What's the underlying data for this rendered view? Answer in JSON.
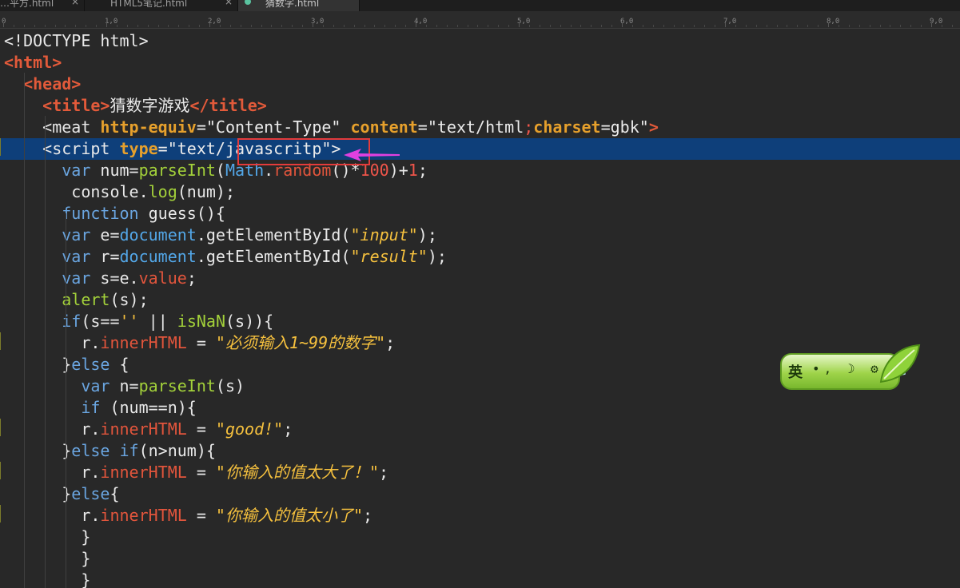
{
  "tabs": [
    {
      "label": "…平方.html",
      "close": "×",
      "active": false
    },
    {
      "label": "HTML5笔记.html",
      "close": "×",
      "active": false
    },
    {
      "label": "猜数字.html",
      "close": "",
      "active": true
    }
  ],
  "ruler": {
    "marks": [
      "0",
      "1,0",
      "2,0",
      "3,0",
      "4,0",
      "5,0",
      "6,0",
      "7,0",
      "8,0",
      "9,0"
    ]
  },
  "code_lines": [
    [
      {
        "t": "<!DOCTYPE html>",
        "c": "plain"
      }
    ],
    [
      {
        "t": "<html>",
        "c": "tag"
      }
    ],
    [
      {
        "t": "  ",
        "c": "plain"
      },
      {
        "t": "<head>",
        "c": "tag"
      }
    ],
    [
      {
        "t": "    ",
        "c": "plain"
      },
      {
        "t": "<title>",
        "c": "tag"
      },
      {
        "t": "猜数字游戏",
        "c": "plain"
      },
      {
        "t": "</title>",
        "c": "tag"
      }
    ],
    [
      {
        "t": "    <meat ",
        "c": "plain"
      },
      {
        "t": "http-equiv",
        "c": "attr"
      },
      {
        "t": "=\"Content-Type\" ",
        "c": "str"
      },
      {
        "t": "content",
        "c": "attr"
      },
      {
        "t": "=\"text/html",
        "c": "str"
      },
      {
        "t": ";",
        "c": "num"
      },
      {
        "t": "charset",
        "c": "attr"
      },
      {
        "t": "=gbk\"",
        "c": "str"
      },
      {
        "t": ">",
        "c": "tag"
      }
    ],
    [
      {
        "t": "    <script ",
        "c": "plain"
      },
      {
        "t": "type",
        "c": "attr"
      },
      {
        "t": "=\"text/javascritp\">",
        "c": "str"
      }
    ],
    [
      {
        "t": "      ",
        "c": "plain"
      },
      {
        "t": "var",
        "c": "kw"
      },
      {
        "t": " num=",
        "c": "plain"
      },
      {
        "t": "parseInt",
        "c": "fn"
      },
      {
        "t": "(",
        "c": "plain"
      },
      {
        "t": "Math",
        "c": "obj"
      },
      {
        "t": ".",
        "c": "plain"
      },
      {
        "t": "random",
        "c": "prop"
      },
      {
        "t": "()*",
        "c": "plain"
      },
      {
        "t": "100",
        "c": "num"
      },
      {
        "t": ")+",
        "c": "plain"
      },
      {
        "t": "1",
        "c": "num"
      },
      {
        "t": ";",
        "c": "plain"
      }
    ],
    [
      {
        "t": "       console.",
        "c": "plain"
      },
      {
        "t": "log",
        "c": "fn"
      },
      {
        "t": "(num);",
        "c": "plain"
      }
    ],
    [
      {
        "t": "      ",
        "c": "plain"
      },
      {
        "t": "function",
        "c": "kw"
      },
      {
        "t": " guess(){",
        "c": "plain"
      }
    ],
    [
      {
        "t": "      ",
        "c": "plain"
      },
      {
        "t": "var",
        "c": "kw"
      },
      {
        "t": " e=",
        "c": "plain"
      },
      {
        "t": "document",
        "c": "obj"
      },
      {
        "t": ".getElementById(",
        "c": "plain"
      },
      {
        "t": "\"input\"",
        "c": "ital"
      },
      {
        "t": ");",
        "c": "plain"
      }
    ],
    [
      {
        "t": "      ",
        "c": "plain"
      },
      {
        "t": "var",
        "c": "kw"
      },
      {
        "t": " r=",
        "c": "plain"
      },
      {
        "t": "document",
        "c": "obj"
      },
      {
        "t": ".getElementById(",
        "c": "plain"
      },
      {
        "t": "\"result\"",
        "c": "ital"
      },
      {
        "t": ");",
        "c": "plain"
      }
    ],
    [
      {
        "t": "      ",
        "c": "plain"
      },
      {
        "t": "var",
        "c": "kw"
      },
      {
        "t": " s=e.",
        "c": "plain"
      },
      {
        "t": "value",
        "c": "prop"
      },
      {
        "t": ";",
        "c": "plain"
      }
    ],
    [
      {
        "t": "      ",
        "c": "plain"
      },
      {
        "t": "alert",
        "c": "fn"
      },
      {
        "t": "(s);",
        "c": "plain"
      }
    ],
    [
      {
        "t": "      ",
        "c": "plain"
      },
      {
        "t": "if",
        "c": "kw"
      },
      {
        "t": "(s==",
        "c": "plain"
      },
      {
        "t": "''",
        "c": "ital"
      },
      {
        "t": " || ",
        "c": "plain"
      },
      {
        "t": "isNaN",
        "c": "fn"
      },
      {
        "t": "(s)){",
        "c": "plain"
      }
    ],
    [
      {
        "t": "        r.",
        "c": "plain"
      },
      {
        "t": "innerHTML",
        "c": "prop"
      },
      {
        "t": " = ",
        "c": "plain"
      },
      {
        "t": "\"必须输入1~99的数字\"",
        "c": "ital"
      },
      {
        "t": ";",
        "c": "plain"
      }
    ],
    [
      {
        "t": "      }",
        "c": "plain"
      },
      {
        "t": "else",
        "c": "kw"
      },
      {
        "t": " {",
        "c": "plain"
      }
    ],
    [
      {
        "t": "        ",
        "c": "plain"
      },
      {
        "t": "var",
        "c": "kw"
      },
      {
        "t": " n=",
        "c": "plain"
      },
      {
        "t": "parseInt",
        "c": "fn"
      },
      {
        "t": "(s)",
        "c": "plain"
      }
    ],
    [
      {
        "t": "        ",
        "c": "plain"
      },
      {
        "t": "if",
        "c": "kw"
      },
      {
        "t": " (num==n){",
        "c": "plain"
      }
    ],
    [
      {
        "t": "        r.",
        "c": "plain"
      },
      {
        "t": "innerHTML",
        "c": "prop"
      },
      {
        "t": " = ",
        "c": "plain"
      },
      {
        "t": "\"good!\"",
        "c": "ital"
      },
      {
        "t": ";",
        "c": "plain"
      }
    ],
    [
      {
        "t": "      }",
        "c": "plain"
      },
      {
        "t": "else if",
        "c": "kw"
      },
      {
        "t": "(n>num){",
        "c": "plain"
      }
    ],
    [
      {
        "t": "        r.",
        "c": "plain"
      },
      {
        "t": "innerHTML",
        "c": "prop"
      },
      {
        "t": " = ",
        "c": "plain"
      },
      {
        "t": "\"你输入的值太大了！\"",
        "c": "ital"
      },
      {
        "t": ";",
        "c": "plain"
      }
    ],
    [
      {
        "t": "      }",
        "c": "plain"
      },
      {
        "t": "else",
        "c": "kw"
      },
      {
        "t": "{",
        "c": "plain"
      }
    ],
    [
      {
        "t": "        r.",
        "c": "plain"
      },
      {
        "t": "innerHTML",
        "c": "prop"
      },
      {
        "t": " = ",
        "c": "plain"
      },
      {
        "t": "\"你输入的值太小了\"",
        "c": "ital"
      },
      {
        "t": ";",
        "c": "plain"
      }
    ],
    [
      {
        "t": "        }",
        "c": "plain"
      }
    ],
    [
      {
        "t": "        }",
        "c": "plain"
      }
    ],
    [
      {
        "t": "        }",
        "c": "plain"
      }
    ]
  ],
  "current_line": 5,
  "ime": {
    "label": "英",
    "icons": "•, ☽ ⚙ 👕"
  },
  "colors": {
    "background": "#282828",
    "current_line": "#0e3f7a",
    "annotation_box": "#e43b3b",
    "arrow": "#e040e0"
  }
}
